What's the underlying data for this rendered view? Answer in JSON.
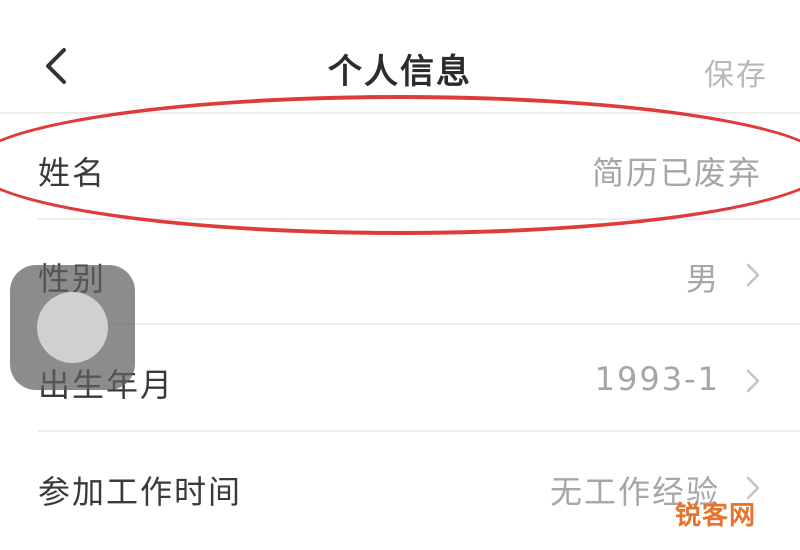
{
  "header": {
    "back_icon": "chevron-left-icon",
    "title": "个人信息",
    "save_label": "保存"
  },
  "rows": [
    {
      "label": "姓名",
      "value": "简历已废弃",
      "chevron": false
    },
    {
      "label": "性别",
      "value": "男",
      "chevron": true
    },
    {
      "label": "出生年月",
      "value": "1993-1",
      "chevron": true
    },
    {
      "label": "参加工作时间",
      "value": "无工作经验",
      "chevron": true
    }
  ],
  "annotation": {
    "color": "#e03a3a"
  },
  "watermark": {
    "text": "锐客网",
    "color": "#e8742c"
  }
}
